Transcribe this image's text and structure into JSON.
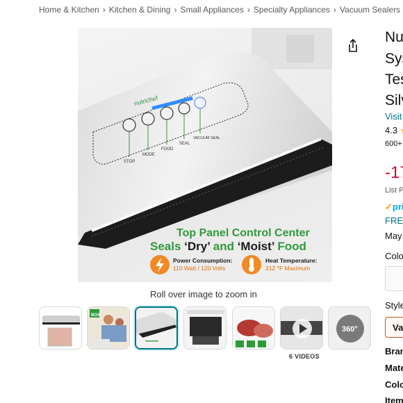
{
  "breadcrumb": [
    "Home & Kitchen",
    "Kitchen & Dining",
    "Small Appliances",
    "Specialty Appliances",
    "Vacuum Sealers"
  ],
  "image": {
    "brand_logo": "nutrichef",
    "buttons": [
      "STOP",
      "MODE",
      "FOOD",
      "SEAL",
      "VACUUM SEAL"
    ],
    "headline_1": "Top Panel Control Center",
    "headline_2_a": "Seals ",
    "headline_2_b": "‘Dry’",
    "headline_2_c": " and ",
    "headline_2_d": "‘Moist’",
    "headline_2_e": " Food",
    "power_label": "Power Consumption:",
    "power_value": "110 Watt / 120 Volts",
    "heat_label": "Heat Temperature:",
    "heat_value": "212 °F Maximum"
  },
  "roll_over": "Roll over image to zoom in",
  "thumb_badge": "BOX",
  "thumb_360": "360°",
  "videos_label": "6 VIDEOS",
  "product": {
    "title_lines": [
      "Nu",
      "Sys",
      "Tes",
      "Silv"
    ],
    "visit": "Visit",
    "rating": "4.3",
    "rating_count": "600+",
    "discount": "-17",
    "list_price": "List P",
    "prime": "pri",
    "free": "FREE",
    "delivery": "May",
    "color_label": "Colo",
    "style_label": "Style",
    "style_value": "Va",
    "specs": [
      "Bran",
      "Mate",
      "Colo",
      "Item"
    ]
  },
  "colors": {
    "accent_green": "#2e9b3a",
    "icon_orange": "#f08a24",
    "link": "#007185",
    "discount": "#cc0c39",
    "selected_border": "#007185"
  }
}
